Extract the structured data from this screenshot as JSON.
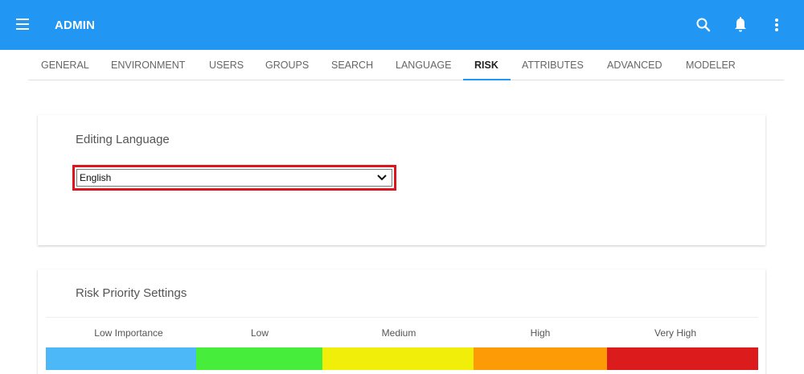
{
  "appbar": {
    "title": "ADMIN",
    "color": "#2196f3",
    "icons": [
      "menu-icon",
      "search-icon",
      "bell-icon",
      "more-vert-icon"
    ]
  },
  "tabs": [
    {
      "label": "GENERAL",
      "active": false
    },
    {
      "label": "ENVIRONMENT",
      "active": false
    },
    {
      "label": "USERS",
      "active": false
    },
    {
      "label": "GROUPS",
      "active": false
    },
    {
      "label": "SEARCH",
      "active": false
    },
    {
      "label": "LANGUAGE",
      "active": false
    },
    {
      "label": "RISK",
      "active": true
    },
    {
      "label": "ATTRIBUTES",
      "active": false
    },
    {
      "label": "ADVANCED",
      "active": false
    },
    {
      "label": "MODELER",
      "active": false
    }
  ],
  "editing_language": {
    "title": "Editing Language",
    "selected": "English",
    "highlight_color": "#e0141e"
  },
  "risk_priority": {
    "title": "Risk Priority Settings",
    "levels": [
      {
        "label": "Low Importance",
        "color": "#4db8f7"
      },
      {
        "label": "Low",
        "color": "#46ee3b"
      },
      {
        "label": "Medium",
        "color": "#f1ee0a"
      },
      {
        "label": "High",
        "color": "#fd9b06"
      },
      {
        "label": "Very High",
        "color": "#dc1c1c"
      }
    ]
  }
}
